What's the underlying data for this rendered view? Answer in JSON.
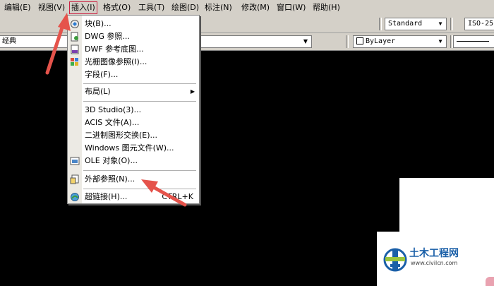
{
  "menubar": {
    "items": [
      {
        "label": "编辑(E)"
      },
      {
        "label": "视图(V)"
      },
      {
        "label": "插入(I)"
      },
      {
        "label": "格式(O)"
      },
      {
        "label": "工具(T)"
      },
      {
        "label": "绘图(D)"
      },
      {
        "label": "标注(N)"
      },
      {
        "label": "修改(M)"
      },
      {
        "label": "窗口(W)"
      },
      {
        "label": "帮助(H)"
      }
    ]
  },
  "toolbar1": {
    "text_style": "Standard",
    "dim_style": "ISO-25"
  },
  "toolbar2": {
    "workspace": "经典",
    "layer": "ByLayer"
  },
  "insert_menu": {
    "items": [
      {
        "label": "块(B)...",
        "icon": "block-icon"
      },
      {
        "label": "DWG 参照...",
        "icon": "dwg-reference-icon"
      },
      {
        "label": "DWF 参考底图...",
        "icon": "dwf-underlay-icon"
      },
      {
        "label": "光栅图像参照(I)...",
        "icon": "raster-image-icon"
      },
      {
        "label": "字段(F)...",
        "icon": ""
      },
      {
        "label": "布局(L)",
        "icon": ""
      },
      {
        "label": "3D Studio(3)...",
        "icon": ""
      },
      {
        "label": "ACIS 文件(A)...",
        "icon": ""
      },
      {
        "label": "二进制图形交换(E)...",
        "icon": ""
      },
      {
        "label": "Windows 图元文件(W)...",
        "icon": ""
      },
      {
        "label": "OLE 对象(O)...",
        "icon": "ole-object-icon"
      },
      {
        "label": "外部参照(N)...",
        "icon": "external-reference-icon"
      },
      {
        "label": "超链接(H)...",
        "icon": "hyperlink-icon",
        "shortcut": "CTRL+K"
      }
    ]
  },
  "watermark": {
    "title": "土木工程网",
    "url": "www.civilcn.com"
  },
  "colors": {
    "menubar_bg": "#d4d0c8",
    "canvas_bg": "#000000",
    "annotation_arrow": "#e5534b",
    "logo_blue": "#1a5fa8"
  }
}
